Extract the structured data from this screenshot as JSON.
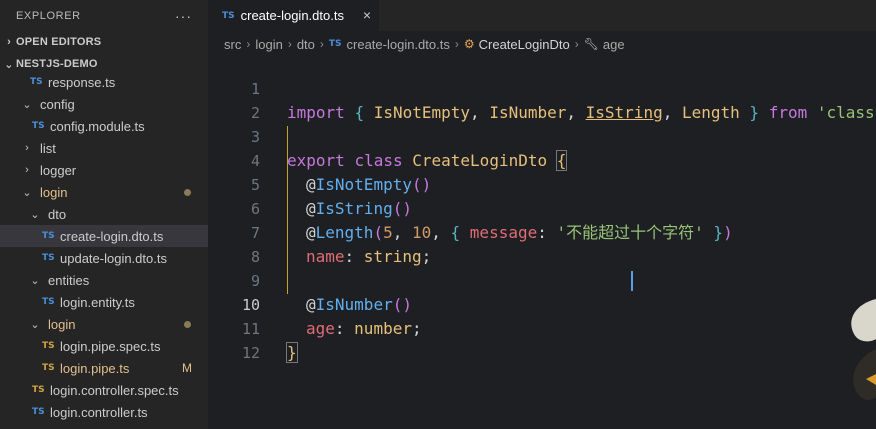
{
  "explorer": {
    "title": "EXPLORER",
    "more_icon": "ellipsis-icon",
    "sections": {
      "open_editors": "OPEN EDITORS",
      "project": "NESTJS-DEMO"
    },
    "tree": [
      {
        "label": "response.ts",
        "type": "file",
        "badge": "TS",
        "selected": false
      },
      {
        "label": "config",
        "type": "folder",
        "expanded": true
      },
      {
        "label": "config.module.ts",
        "type": "file",
        "badge": "TS"
      },
      {
        "label": "list",
        "type": "folder",
        "expanded": false
      },
      {
        "label": "logger",
        "type": "folder",
        "expanded": false
      },
      {
        "label": "login",
        "type": "folder",
        "expanded": true,
        "modified_dot": true
      },
      {
        "label": "dto",
        "type": "folder",
        "expanded": true
      },
      {
        "label": "create-login.dto.ts",
        "type": "file",
        "badge": "TS",
        "selected": true
      },
      {
        "label": "update-login.dto.ts",
        "type": "file",
        "badge": "TS"
      },
      {
        "label": "entities",
        "type": "folder",
        "expanded": true
      },
      {
        "label": "login.entity.ts",
        "type": "file",
        "badge": "TS"
      },
      {
        "label": "login",
        "type": "folder",
        "expanded": true,
        "modified_dot": true
      },
      {
        "label": "login.pipe.spec.ts",
        "type": "file",
        "badge": "TS"
      },
      {
        "label": "login.pipe.ts",
        "type": "file",
        "badge": "TS",
        "status": "M"
      },
      {
        "label": "login.controller.spec.ts",
        "type": "file",
        "badge": "TS"
      },
      {
        "label": "login.controller.ts",
        "type": "file",
        "badge": "TS"
      }
    ]
  },
  "tab": {
    "badge": "TS",
    "label": "create-login.dto.ts",
    "close": "×"
  },
  "breadcrumb": {
    "items": [
      "src",
      "login",
      "dto"
    ],
    "file_badge": "TS",
    "file": "create-login.dto.ts",
    "class": "CreateLoginDto",
    "member": "age"
  },
  "code": {
    "line_numbers": [
      "1",
      "2",
      "3",
      "4",
      "5",
      "6",
      "7",
      "8",
      "9",
      "10",
      "11",
      "12"
    ],
    "active_line": "10",
    "l1": {
      "import": "import",
      "open": "{",
      "a": "IsNotEmpty",
      "b": "IsNumber",
      "c": "IsString",
      "d": "Length",
      "close": "}",
      "from": "from",
      "src": "'class-validator';"
    },
    "l3": {
      "export": "export",
      "class": "class",
      "name": "CreateLoginDto",
      "brace": "{"
    },
    "l4": {
      "dec": "IsNotEmpty",
      "call": "()"
    },
    "l5": {
      "dec": "IsString",
      "call": "()"
    },
    "l6": {
      "dec": "Length",
      "a": "5",
      "b": "10",
      "key": "message",
      "val": "'不能超过十个字符'"
    },
    "l7": {
      "prop": "name",
      "type": "string"
    },
    "l9": {
      "dec": "IsNumber",
      "call": "()"
    },
    "l10": {
      "prop": "age",
      "type": "number"
    },
    "l11": {
      "brace": "}"
    }
  },
  "colors": {
    "keyword": "#c678dd",
    "class": "#e5c07b",
    "decorator": "#61afef",
    "number": "#d19a66",
    "string": "#98c379",
    "property": "#e06c75",
    "ts_badge": "#4b8fd8"
  }
}
